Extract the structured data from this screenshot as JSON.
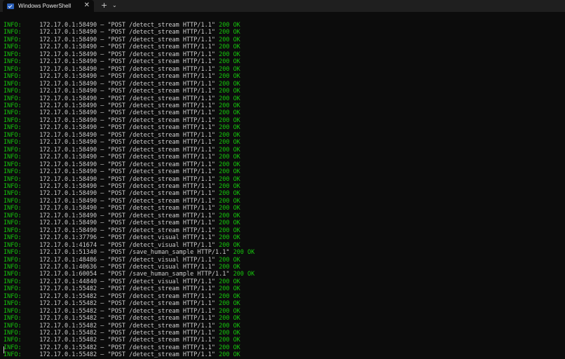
{
  "window": {
    "tab_title": "Windows PowerShell",
    "close_glyph": "✕",
    "new_tab_glyph": "+",
    "dropdown_glyph": "⌄",
    "icon": "powershell-icon"
  },
  "colors": {
    "background": "#0c0c0c",
    "text": "#cccccc",
    "level": "#16c60c",
    "status": "#16c60c",
    "titlebar": "#1f1f1f"
  },
  "log_lines": [
    {
      "level": "INFO:",
      "addr": "172.17.0.1:58490",
      "request": "\"POST /detect_stream HTTP/1.1\"",
      "status": "200 OK"
    },
    {
      "level": "INFO:",
      "addr": "172.17.0.1:58490",
      "request": "\"POST /detect_stream HTTP/1.1\"",
      "status": "200 OK"
    },
    {
      "level": "INFO:",
      "addr": "172.17.0.1:58490",
      "request": "\"POST /detect_stream HTTP/1.1\"",
      "status": "200 OK"
    },
    {
      "level": "INFO:",
      "addr": "172.17.0.1:58490",
      "request": "\"POST /detect_stream HTTP/1.1\"",
      "status": "200 OK"
    },
    {
      "level": "INFO:",
      "addr": "172.17.0.1:58490",
      "request": "\"POST /detect_stream HTTP/1.1\"",
      "status": "200 OK"
    },
    {
      "level": "INFO:",
      "addr": "172.17.0.1:58490",
      "request": "\"POST /detect_stream HTTP/1.1\"",
      "status": "200 OK"
    },
    {
      "level": "INFO:",
      "addr": "172.17.0.1:58490",
      "request": "\"POST /detect_stream HTTP/1.1\"",
      "status": "200 OK"
    },
    {
      "level": "INFO:",
      "addr": "172.17.0.1:58490",
      "request": "\"POST /detect_stream HTTP/1.1\"",
      "status": "200 OK"
    },
    {
      "level": "INFO:",
      "addr": "172.17.0.1:58490",
      "request": "\"POST /detect_stream HTTP/1.1\"",
      "status": "200 OK"
    },
    {
      "level": "INFO:",
      "addr": "172.17.0.1:58490",
      "request": "\"POST /detect_stream HTTP/1.1\"",
      "status": "200 OK"
    },
    {
      "level": "INFO:",
      "addr": "172.17.0.1:58490",
      "request": "\"POST /detect_stream HTTP/1.1\"",
      "status": "200 OK"
    },
    {
      "level": "INFO:",
      "addr": "172.17.0.1:58490",
      "request": "\"POST /detect_stream HTTP/1.1\"",
      "status": "200 OK"
    },
    {
      "level": "INFO:",
      "addr": "172.17.0.1:58490",
      "request": "\"POST /detect_stream HTTP/1.1\"",
      "status": "200 OK"
    },
    {
      "level": "INFO:",
      "addr": "172.17.0.1:58490",
      "request": "\"POST /detect_stream HTTP/1.1\"",
      "status": "200 OK"
    },
    {
      "level": "INFO:",
      "addr": "172.17.0.1:58490",
      "request": "\"POST /detect_stream HTTP/1.1\"",
      "status": "200 OK"
    },
    {
      "level": "INFO:",
      "addr": "172.17.0.1:58490",
      "request": "\"POST /detect_stream HTTP/1.1\"",
      "status": "200 OK"
    },
    {
      "level": "INFO:",
      "addr": "172.17.0.1:58490",
      "request": "\"POST /detect_stream HTTP/1.1\"",
      "status": "200 OK"
    },
    {
      "level": "INFO:",
      "addr": "172.17.0.1:58490",
      "request": "\"POST /detect_stream HTTP/1.1\"",
      "status": "200 OK"
    },
    {
      "level": "INFO:",
      "addr": "172.17.0.1:58490",
      "request": "\"POST /detect_stream HTTP/1.1\"",
      "status": "200 OK"
    },
    {
      "level": "INFO:",
      "addr": "172.17.0.1:58490",
      "request": "\"POST /detect_stream HTTP/1.1\"",
      "status": "200 OK"
    },
    {
      "level": "INFO:",
      "addr": "172.17.0.1:58490",
      "request": "\"POST /detect_stream HTTP/1.1\"",
      "status": "200 OK"
    },
    {
      "level": "INFO:",
      "addr": "172.17.0.1:58490",
      "request": "\"POST /detect_stream HTTP/1.1\"",
      "status": "200 OK"
    },
    {
      "level": "INFO:",
      "addr": "172.17.0.1:58490",
      "request": "\"POST /detect_stream HTTP/1.1\"",
      "status": "200 OK"
    },
    {
      "level": "INFO:",
      "addr": "172.17.0.1:58490",
      "request": "\"POST /detect_stream HTTP/1.1\"",
      "status": "200 OK"
    },
    {
      "level": "INFO:",
      "addr": "172.17.0.1:58490",
      "request": "\"POST /detect_stream HTTP/1.1\"",
      "status": "200 OK"
    },
    {
      "level": "INFO:",
      "addr": "172.17.0.1:58490",
      "request": "\"POST /detect_stream HTTP/1.1\"",
      "status": "200 OK"
    },
    {
      "level": "INFO:",
      "addr": "172.17.0.1:58490",
      "request": "\"POST /detect_stream HTTP/1.1\"",
      "status": "200 OK"
    },
    {
      "level": "INFO:",
      "addr": "172.17.0.1:58490",
      "request": "\"POST /detect_stream HTTP/1.1\"",
      "status": "200 OK"
    },
    {
      "level": "INFO:",
      "addr": "172.17.0.1:58490",
      "request": "\"POST /detect_stream HTTP/1.1\"",
      "status": "200 OK"
    },
    {
      "level": "INFO:",
      "addr": "172.17.0.1:37796",
      "request": "\"POST /detect_visual HTTP/1.1\"",
      "status": "200 OK"
    },
    {
      "level": "INFO:",
      "addr": "172.17.0.1:41674",
      "request": "\"POST /detect_visual HTTP/1.1\"",
      "status": "200 OK"
    },
    {
      "level": "INFO:",
      "addr": "172.17.0.1:51340",
      "request": "\"POST /save_human_sample HTTP/1.1\"",
      "status": "200 OK"
    },
    {
      "level": "INFO:",
      "addr": "172.17.0.1:48486",
      "request": "\"POST /detect_visual HTTP/1.1\"",
      "status": "200 OK"
    },
    {
      "level": "INFO:",
      "addr": "172.17.0.1:40636",
      "request": "\"POST /detect_visual HTTP/1.1\"",
      "status": "200 OK"
    },
    {
      "level": "INFO:",
      "addr": "172.17.0.1:60054",
      "request": "\"POST /save_human_sample HTTP/1.1\"",
      "status": "200 OK"
    },
    {
      "level": "INFO:",
      "addr": "172.17.0.1:44840",
      "request": "\"POST /detect_visual HTTP/1.1\"",
      "status": "200 OK"
    },
    {
      "level": "INFO:",
      "addr": "172.17.0.1:55482",
      "request": "\"POST /detect_stream HTTP/1.1\"",
      "status": "200 OK"
    },
    {
      "level": "INFO:",
      "addr": "172.17.0.1:55482",
      "request": "\"POST /detect_stream HTTP/1.1\"",
      "status": "200 OK"
    },
    {
      "level": "INFO:",
      "addr": "172.17.0.1:55482",
      "request": "\"POST /detect_stream HTTP/1.1\"",
      "status": "200 OK"
    },
    {
      "level": "INFO:",
      "addr": "172.17.0.1:55482",
      "request": "\"POST /detect_stream HTTP/1.1\"",
      "status": "200 OK"
    },
    {
      "level": "INFO:",
      "addr": "172.17.0.1:55482",
      "request": "\"POST /detect_stream HTTP/1.1\"",
      "status": "200 OK"
    },
    {
      "level": "INFO:",
      "addr": "172.17.0.1:55482",
      "request": "\"POST /detect_stream HTTP/1.1\"",
      "status": "200 OK"
    },
    {
      "level": "INFO:",
      "addr": "172.17.0.1:55482",
      "request": "\"POST /detect_stream HTTP/1.1\"",
      "status": "200 OK"
    },
    {
      "level": "INFO:",
      "addr": "172.17.0.1:55482",
      "request": "\"POST /detect_stream HTTP/1.1\"",
      "status": "200 OK"
    },
    {
      "level": "INFO:",
      "addr": "172.17.0.1:55482",
      "request": "\"POST /detect_stream HTTP/1.1\"",
      "status": "200 OK"
    },
    {
      "level": "INFO:",
      "addr": "172.17.0.1:55482",
      "request": "\"POST /detect_stream HTTP/1.1\"",
      "status": "200 OK"
    }
  ]
}
